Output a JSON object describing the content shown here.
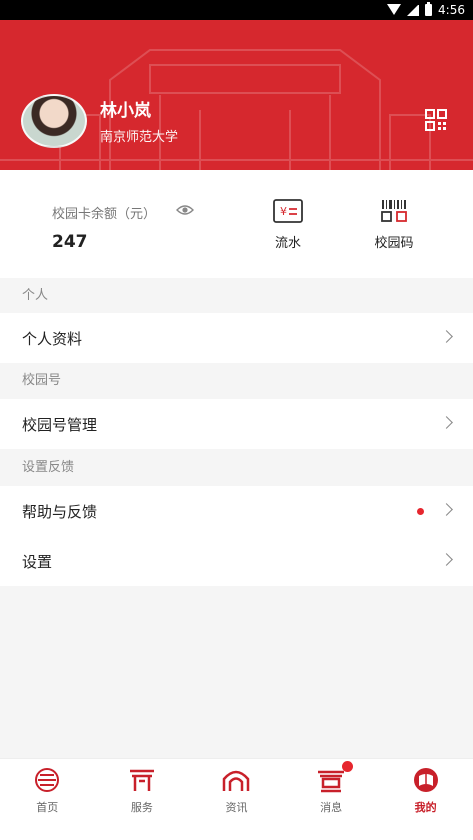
{
  "status_bar": {
    "time": "4:56"
  },
  "profile": {
    "name": "林小岚",
    "school": "南京师范大学"
  },
  "card": {
    "balance_label": "校园卡余额（元）",
    "balance_value": "247",
    "shortcuts": [
      {
        "label": "流水",
        "icon": "bill-icon"
      },
      {
        "label": "校园码",
        "icon": "barcode-icon"
      }
    ]
  },
  "sections": {
    "personal": {
      "title": "个人",
      "items": [
        "个人资料"
      ]
    },
    "campus": {
      "title": "校园号",
      "items": [
        "校园号管理"
      ]
    },
    "settings": {
      "title": "设置反馈",
      "items": [
        "帮助与反馈",
        "设置"
      ]
    }
  },
  "bottom_nav": [
    {
      "label": "首页",
      "icon": "home-icon"
    },
    {
      "label": "服务",
      "icon": "service-icon"
    },
    {
      "label": "资讯",
      "icon": "news-icon"
    },
    {
      "label": "消息",
      "icon": "message-icon"
    },
    {
      "label": "我的",
      "icon": "profile-icon",
      "active": true
    }
  ],
  "colors": {
    "brand": "#d6282e",
    "active": "#c8202a",
    "badge": "#e6262e"
  }
}
